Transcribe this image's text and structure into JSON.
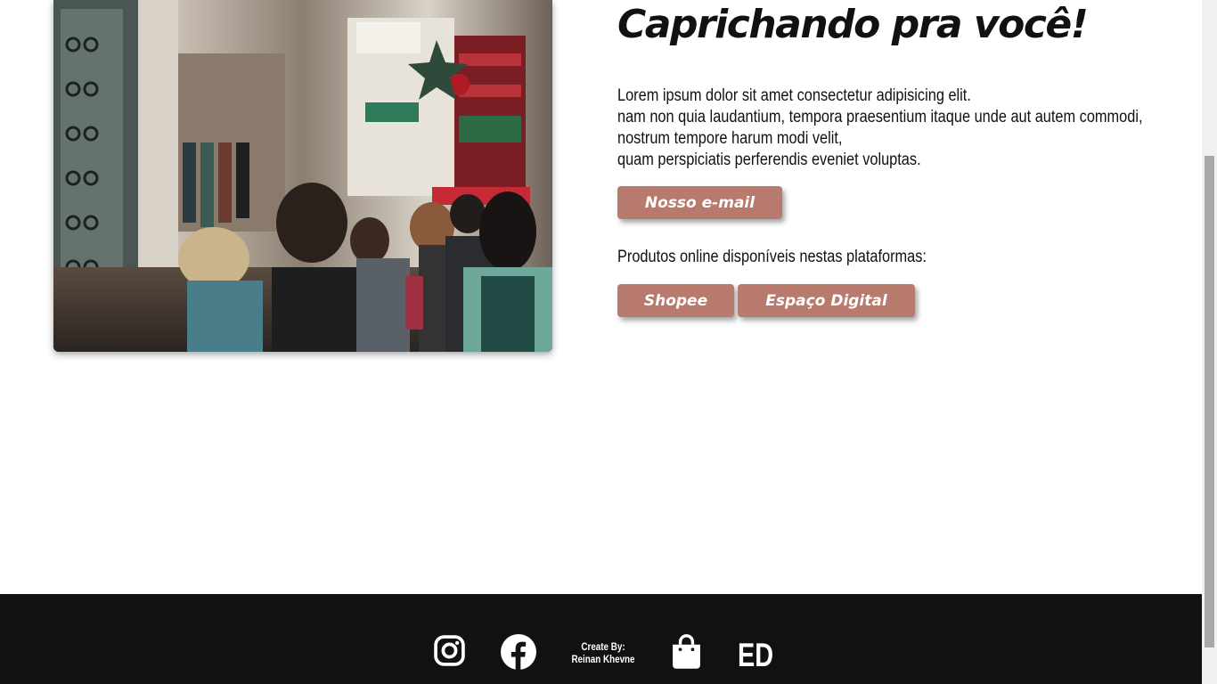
{
  "hero": {
    "title": "Caprichando pra você!",
    "description_lines": [
      "Lorem ipsum dolor sit amet consectetur adipisicing elit.",
      "nam non quia laudantium, tempora praesentium itaque unde aut autem commodi,",
      "nostrum tempore harum modi velit,",
      "quam perspiciatis perferendis eveniet voluptas."
    ],
    "email_button": "Nosso e-mail",
    "platforms_text": "Produtos online disponíveis nestas plataformas:",
    "platform_buttons": [
      "Shopee",
      "Espaço Digital"
    ]
  },
  "photo": {
    "icon": "shopping-street-photo"
  },
  "footer": {
    "credit_line1": "Create By:",
    "credit_line2": "Reinan Khevne",
    "logo_text": "ED",
    "icons": [
      "instagram-icon",
      "facebook-icon",
      "shopping-bag-icon"
    ]
  },
  "colors": {
    "button": "#b87a6d",
    "footer": "#111111",
    "text": "#111111"
  }
}
